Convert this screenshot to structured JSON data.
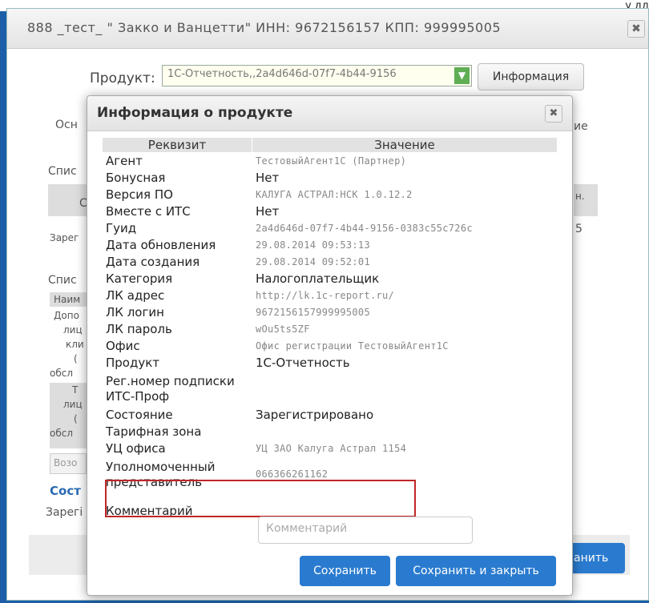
{
  "top_corner_text": "у дд",
  "outer_window": {
    "title": "888 _тест_ \" Закко и Ванцетти\" ИНН: 9672156157 КПП: 999995005",
    "close_symbol": "✖"
  },
  "product": {
    "label": "Продукт:",
    "selected_value": "1С-Отчетность,,2a4d646d-07f7-4b44-9156",
    "info_button": "Информация"
  },
  "background_fragments": {
    "osn": "Осн",
    "ie": "ие",
    "spis1": "Спис",
    "c": "С",
    "n": "н.",
    "zareg": "Зарег",
    "five": "5",
    "spis2": "Спис",
    "naim": "Наим",
    "dopo": "Допо",
    "litsi": "лиц",
    "kli": "кли",
    "paren": "(",
    "obsl": "обсл",
    "t": "Т",
    "litsi2": "лиц",
    "paren2": "(",
    "obsl2": "обсл",
    "vozo": "Возо",
    "sost": "Сост",
    "zaregi": "Зарегі",
    "save_partial": "анить"
  },
  "dialog": {
    "title": "Информация о продукте",
    "close_symbol": "✖",
    "columns": [
      "Реквизит",
      "Значение"
    ],
    "rows": [
      {
        "key": "Агент",
        "value": "ТестовыйАгент1С (Партнер)"
      },
      {
        "key": "Бонусная",
        "value": "Нет"
      },
      {
        "key": "Версия ПО",
        "value": "КАЛУГА АСТРАЛ:НСК 1.0.12.2"
      },
      {
        "key": "Вместе с ИТС",
        "value": "Нет"
      },
      {
        "key": "Гуид",
        "value": "2a4d646d-07f7-4b44-9156-0383c55c726c"
      },
      {
        "key": "Дата обновления",
        "value": "29.08.2014 09:53:13"
      },
      {
        "key": "Дата создания",
        "value": "29.08.2014 09:52:01"
      },
      {
        "key": "Категория",
        "value": "Налогоплательщик"
      },
      {
        "key": "ЛК адрес",
        "value": "http://lk.1c-report.ru/"
      },
      {
        "key": "ЛК логин",
        "value": "9672156157999995005"
      },
      {
        "key": "ЛК пароль",
        "value": "wOu5ts5ZF"
      },
      {
        "key": "Офис",
        "value": "Офис регистрации ТестовыйАгент1С"
      },
      {
        "key": "Продукт",
        "value": "1С-Отчетность"
      },
      {
        "key": "Рег.номер подписки ИТС-Проф",
        "value": ""
      },
      {
        "key": "Состояние",
        "value": "Зарегистрировано"
      },
      {
        "key": "Тарифная зона",
        "value": ""
      },
      {
        "key": "УЦ офиса",
        "value": "УЦ ЗАО Калуга Астрал 1154"
      },
      {
        "key": "Уполномоченный представитель",
        "value": "066366261162"
      },
      {
        "key": "Комментарий",
        "value": ""
      }
    ],
    "comment_placeholder": "Комментарий",
    "save_button": "Сохранить",
    "save_close_button": "Сохранить и закрыть"
  }
}
